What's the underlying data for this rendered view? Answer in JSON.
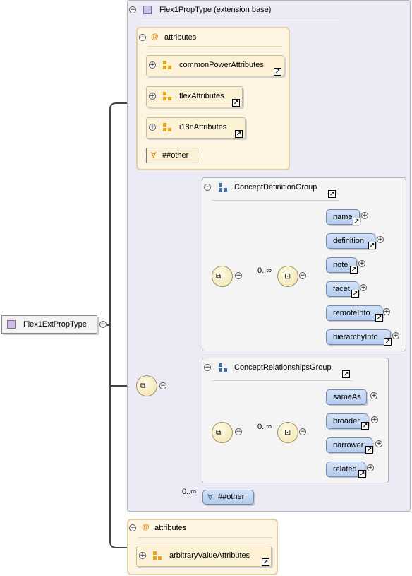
{
  "root": {
    "name": "Flex1ExtPropType"
  },
  "extension": {
    "title": "Flex1PropType (extension base)"
  },
  "attributes_1": {
    "label": "attributes",
    "groups": [
      "commonPowerAttributes",
      "flexAttributes",
      "i18nAttributes"
    ],
    "other": "##other"
  },
  "concept_def_group": {
    "title": "ConceptDefinitionGroup",
    "multiplicity": "0..∞",
    "elements": [
      "name",
      "definition",
      "note",
      "facet",
      "remoteInfo",
      "hierarchyInfo"
    ]
  },
  "concept_rel_group": {
    "title": "ConceptRelationshipsGroup",
    "multiplicity": "0..∞",
    "elements": [
      "sameAs",
      "broader",
      "narrower",
      "related"
    ]
  },
  "any_other": {
    "multiplicity": "0..∞",
    "label": "##other"
  },
  "attributes_2": {
    "label": "attributes",
    "groups": [
      "arbitraryValueAttributes"
    ]
  }
}
